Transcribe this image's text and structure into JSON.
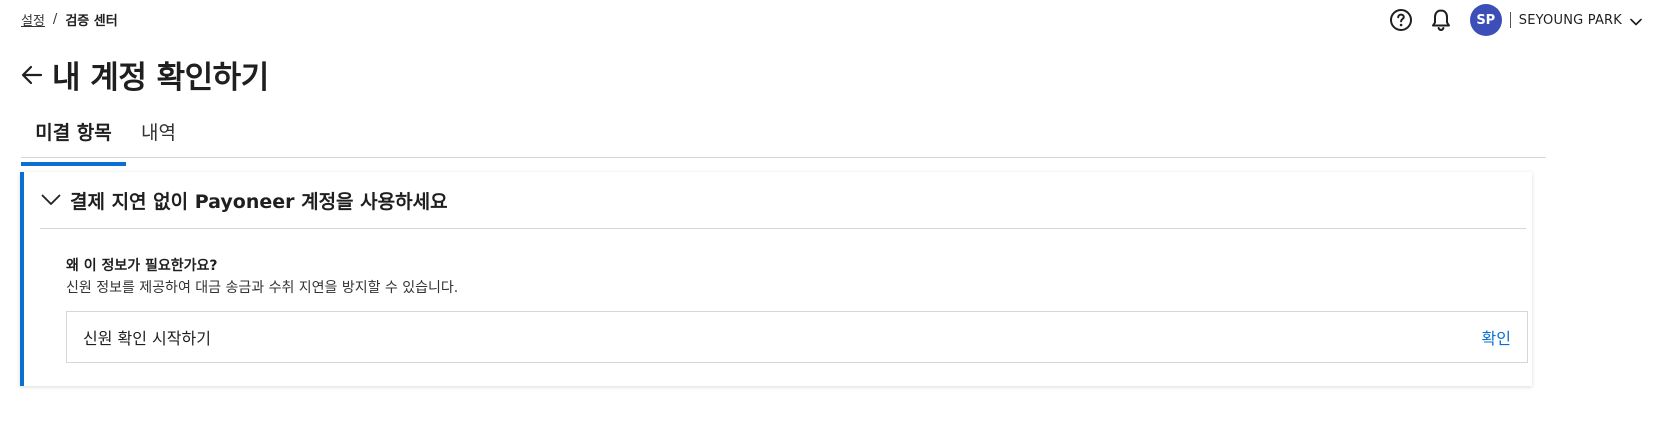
{
  "breadcrumb": {
    "items": [
      {
        "label": "설정"
      },
      {
        "label": "검증 센터"
      }
    ],
    "separator": "/"
  },
  "header": {
    "help_icon": "help-circle-icon",
    "notification_icon": "bell-icon",
    "avatar_initials": "SP",
    "user_name": "SEYOUNG PARK",
    "user_menu_icon": "chevron-down-icon"
  },
  "page": {
    "title": "내 계정 확인하기",
    "back_icon": "arrow-left-icon"
  },
  "tabs": [
    {
      "label": "미결 항목",
      "active": true
    },
    {
      "label": "내역",
      "active": false
    }
  ],
  "card": {
    "title": "결제 지연 없이 Payoneer 계정을 사용하세요",
    "expanded": true,
    "why_title": "왜 이 정보가 필요한가요?",
    "why_description": "신원 정보를 제공하여 대금 송금과 수취 지연을 방지할 수 있습니다.",
    "action": {
      "label": "신원 확인 시작하기",
      "link": "확인"
    }
  },
  "colors": {
    "accent": "#0a6fd1",
    "avatar_bg": "#3c4fb8",
    "divider": "#d6d6d6"
  }
}
